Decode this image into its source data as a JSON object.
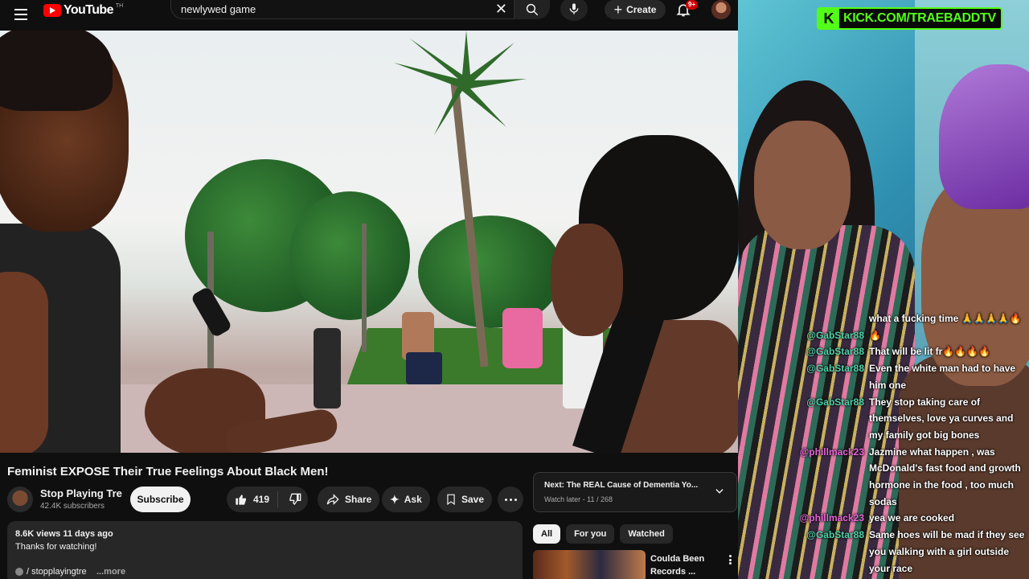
{
  "youtube": {
    "logo_text": "YouTube",
    "logo_sup": "TH",
    "search": {
      "query": "newlywed game"
    },
    "create_label": "Create",
    "notifications_badge": "9+",
    "video": {
      "title": "Feminist EXPOSE Their True Feelings About Black Men!",
      "channel_name": "Stop Playing Tre",
      "subscribers": "42.4K subscribers",
      "subscribe_label": "Subscribe",
      "likes": "419",
      "share_label": "Share",
      "ask_label": "Ask",
      "save_label": "Save"
    },
    "description": {
      "views_date": "8.6K views  11 days ago",
      "line1": "Thanks for watching!",
      "link": "/ stopplayingtre",
      "more_label": "...more"
    },
    "next_up": {
      "title": "Next: The REAL Cause of Dementia Yo...",
      "subtitle": "Watch later - 11 / 268"
    },
    "chips": [
      {
        "label": "All",
        "active": true
      },
      {
        "label": "For you",
        "active": false
      },
      {
        "label": "Watched",
        "active": false
      }
    ],
    "recommendation": {
      "title": "Coulda Been Records ..."
    }
  },
  "stream": {
    "kick_letter": "K",
    "kick_url": "KICK.COM/TRAEBADDTV",
    "chat": [
      {
        "user": "",
        "text": "what a fucking time 🙏🙏🙏🙏🔥",
        "color": "#ffffff"
      },
      {
        "user": "@GabStar88",
        "text": "🔥",
        "color": "#4fd1a8"
      },
      {
        "user": "@GabStar88",
        "text": "That will be lit fr🔥🔥🔥🔥",
        "color": "#4fd1a8"
      },
      {
        "user": "@GabStar88",
        "text": "Even the white man had to have him one",
        "color": "#4fd1a8"
      },
      {
        "user": "@GabStar88",
        "text": "They stop taking care of themselves, love ya curves and my family got big bones",
        "color": "#4fd1a8"
      },
      {
        "user": "@phillmack23",
        "text": "Jazmine what happen , was McDonald's fast food and growth hormone in the food , too much sodas",
        "color": "#e865d8"
      },
      {
        "user": "@phillmack23",
        "text": "yea we are cooked",
        "color": "#e865d8"
      },
      {
        "user": "@GabStar88",
        "text": "Same hoes will be mad if they see you walking with a girl outside your race",
        "color": "#4fd1a8"
      }
    ]
  }
}
